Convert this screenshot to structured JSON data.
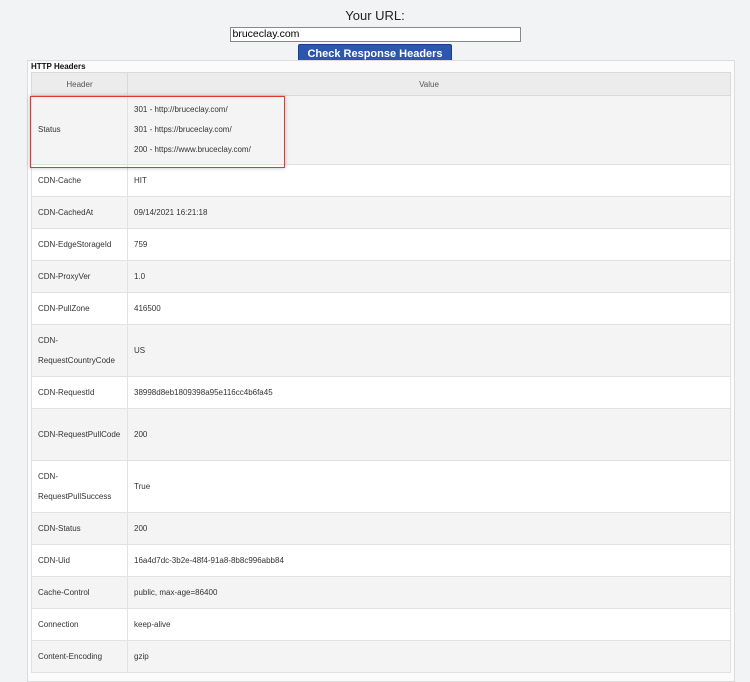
{
  "form": {
    "label": "Your URL:",
    "url_value": "bruceclay.com",
    "submit_label": "Check Response Headers"
  },
  "panel": {
    "title": "HTTP Headers",
    "columns": [
      "Header",
      "Value"
    ],
    "status": {
      "key": "Status",
      "values": [
        "301 - http://bruceclay.com/",
        "301 - https://bruceclay.com/",
        "200 - https://www.bruceclay.com/"
      ]
    },
    "rows": [
      {
        "key": "CDN-Cache",
        "value": "HIT"
      },
      {
        "key": "CDN-CachedAt",
        "value": "09/14/2021 16:21:18"
      },
      {
        "key": "CDN-EdgeStorageId",
        "value": "759"
      },
      {
        "key": "CDN-ProxyVer",
        "value": "1.0"
      },
      {
        "key": "CDN-PullZone",
        "value": "416500"
      },
      {
        "key": "CDN-RequestCountryCode",
        "value": "US"
      },
      {
        "key": "CDN-RequestId",
        "value": "38998d8eb1809398a95e116cc4b6fa45"
      },
      {
        "key": "CDN-RequestPullCode",
        "value": "200"
      },
      {
        "key": "CDN-RequestPullSuccess",
        "value": "True"
      },
      {
        "key": "CDN-Status",
        "value": "200"
      },
      {
        "key": "CDN-Uid",
        "value": "16a4d7dc-3b2e-48f4-91a8-8b8c996abb84"
      },
      {
        "key": "Cache-Control",
        "value": "public, max-age=86400"
      },
      {
        "key": "Connection",
        "value": "keep-alive"
      },
      {
        "key": "Content-Encoding",
        "value": "gzip"
      }
    ]
  },
  "colors": {
    "button": "#2b57ae",
    "highlight": "#e2372c"
  }
}
